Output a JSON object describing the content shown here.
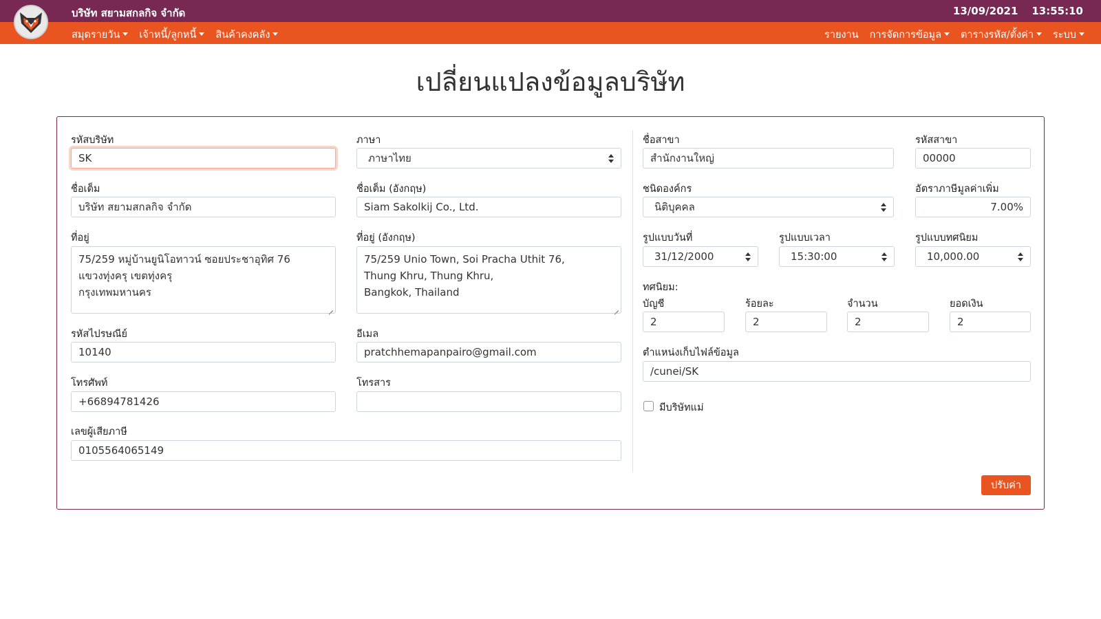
{
  "app": {
    "company_name": "บริษัท สยามสกลกิจ จำกัด",
    "date": "13/09/2021",
    "time": "13:55:10"
  },
  "nav": {
    "left": [
      "สมุดรายวัน",
      "เจ้าหนี้/ลูกหนี้",
      "สินค้าคงคลัง"
    ],
    "right": [
      "รายงาน",
      "การจัดการข้อมูล",
      "ตารางรหัส/ตั้งค่า",
      "ระบบ"
    ]
  },
  "page": {
    "title": "เปลี่ยนแปลงข้อมูลบริษัท"
  },
  "form": {
    "company_code": {
      "label": "รหัสบริษัท",
      "value": "SK"
    },
    "language": {
      "label": "ภาษา",
      "value": "ภาษาไทย"
    },
    "full_name": {
      "label": "ชื่อเต็ม",
      "value": "บริษัท สยามสกลกิจ จำกัด"
    },
    "full_name_en": {
      "label": "ชื่อเต็ม (อังกฤษ)",
      "value": "Siam Sakolkij Co., Ltd."
    },
    "address": {
      "label": "ที่อยู่",
      "value": "75/259 หมู่บ้านยูนิโอทาวน์ ซอยประชาอุทิศ 76\nแขวงทุ่งครุ เขตทุ่งครุ\nกรุงเทพมหานคร"
    },
    "address_en": {
      "label": "ที่อยู่ (อังกฤษ)",
      "value": "75/259 Unio Town, Soi Pracha Uthit 76,\nThung Khru, Thung Khru,\nBangkok, Thailand"
    },
    "postal_code": {
      "label": "รหัสไปรษณีย์",
      "value": "10140"
    },
    "email": {
      "label": "อีเมล",
      "value": "pratchhemapanpairo@gmail.com"
    },
    "phone": {
      "label": "โทรศัพท์",
      "value": "+66894781426"
    },
    "fax": {
      "label": "โทรสาร",
      "value": ""
    },
    "tax_id": {
      "label": "เลขผู้เสียภาษี",
      "value": "0105564065149"
    },
    "branch_name": {
      "label": "ชื่อสาขา",
      "value": "สำนักงานใหญ่"
    },
    "branch_code": {
      "label": "รหัสสาขา",
      "value": "00000"
    },
    "org_type": {
      "label": "ชนิดองค์กร",
      "value": "นิติบุคคล"
    },
    "vat_rate": {
      "label": "อัตราภาษีมูลค่าเพิ่ม",
      "value": "7.00%"
    },
    "date_format": {
      "label": "รูปแบบวันที่",
      "value": "31/12/2000"
    },
    "time_format": {
      "label": "รูปแบบเวลา",
      "value": "15:30:00"
    },
    "decimal_format": {
      "label": "รูปแบบทศนิยม",
      "value": "10,000.00"
    },
    "decimals_heading": "ทศนิยม:",
    "dec_account": {
      "label": "บัญชี",
      "value": "2"
    },
    "dec_percent": {
      "label": "ร้อยละ",
      "value": "2"
    },
    "dec_quantity": {
      "label": "จำนวน",
      "value": "2"
    },
    "dec_amount": {
      "label": "ยอดเงิน",
      "value": "2"
    },
    "data_path": {
      "label": "ตำแหน่งเก็บไฟล์ข้อมูล",
      "value": "/cunei/SK"
    },
    "has_parent": {
      "label": "มีบริษัทแม่",
      "checked": false
    },
    "submit_label": "ปรับค่า"
  },
  "colors": {
    "topbar": "#772953",
    "navbar": "#e95420",
    "accent": "#e95420"
  }
}
